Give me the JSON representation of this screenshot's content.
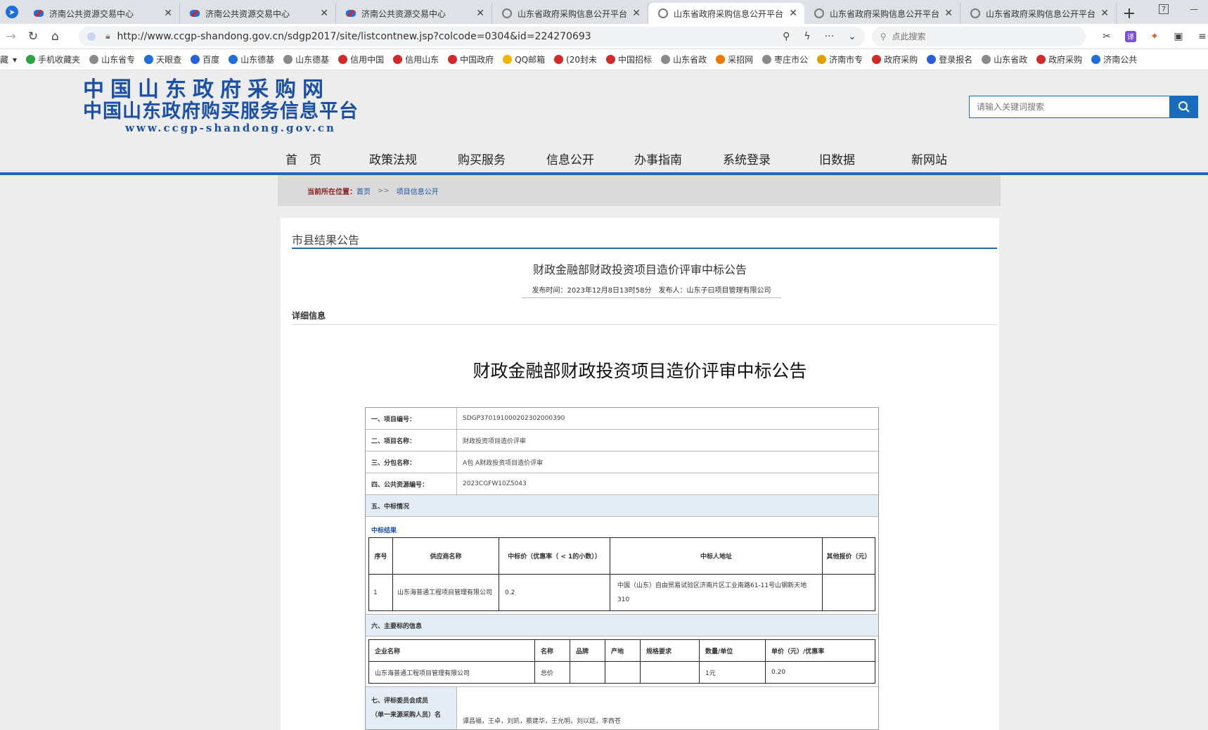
{
  "browser": {
    "tabs": [
      {
        "label": "济南公共资源交易中心",
        "active": false
      },
      {
        "label": "济南公共资源交易中心",
        "active": false
      },
      {
        "label": "济南公共资源交易中心",
        "active": false
      },
      {
        "label": "山东省政府采购信息公开平台",
        "active": false
      },
      {
        "label": "山东省政府采购信息公开平台",
        "active": true
      },
      {
        "label": "山东省政府采购信息公开平台",
        "active": false
      },
      {
        "label": "山东省政府采购信息公开平台",
        "active": false
      }
    ],
    "close_glyph": "✕",
    "new_tab_glyph": "+",
    "tab_badge": "7",
    "url": "http://www.ccgp-shandong.gov.cn/sdgp2017/site/listcontnew.jsp?colcode=0304&id=224270693",
    "search_placeholder": "点此搜索",
    "bookmarks": [
      {
        "label": "藏",
        "color": "#ffffff"
      },
      {
        "label": "手机收藏夹",
        "color": "#2ba245"
      },
      {
        "label": "山东省专",
        "color": "#8a8a8a"
      },
      {
        "label": "天眼查",
        "color": "#1e6fd9"
      },
      {
        "label": "百度",
        "color": "#2b5ed8"
      },
      {
        "label": "山东德基",
        "color": "#1e6fd9"
      },
      {
        "label": "山东德基",
        "color": "#8a8a8a"
      },
      {
        "label": "信用中国",
        "color": "#d02a2a"
      },
      {
        "label": "信用山东",
        "color": "#d02a2a"
      },
      {
        "label": "中国政府",
        "color": "#d02a2a"
      },
      {
        "label": "QQ邮箱",
        "color": "#f0b400"
      },
      {
        "label": "(20封未",
        "color": "#d02a2a"
      },
      {
        "label": "中国招标",
        "color": "#d02a2a"
      },
      {
        "label": "山东省政",
        "color": "#8a8a8a"
      },
      {
        "label": "采招网",
        "color": "#f07a00"
      },
      {
        "label": "枣庄市公",
        "color": "#8a8a8a"
      },
      {
        "label": "济南市专",
        "color": "#e2a000"
      },
      {
        "label": "政府采购",
        "color": "#d02a2a"
      },
      {
        "label": "登录报名",
        "color": "#2b5ed8"
      },
      {
        "label": "山东省政",
        "color": "#8a8a8a"
      },
      {
        "label": "政府采购",
        "color": "#d02a2a"
      },
      {
        "label": "济南公共",
        "color": "#1e6fd9"
      }
    ]
  },
  "site": {
    "logo_line1": "中国山东政府采购网",
    "logo_line2": "中国山东政府购买服务信息平台",
    "logo_line3": "www.ccgp-shandong.gov.cn",
    "search_placeholder": "请输入关键词搜索",
    "nav": [
      "首　页",
      "政策法规",
      "购买服务",
      "信息公开",
      "办事指南",
      "系统登录",
      "旧数据",
      "新网站"
    ],
    "breadcrumb": {
      "label": "当前所在位置：",
      "home": "首页",
      "sep": ">>",
      "current": "项目信息公开"
    },
    "accent": "#1b6bbd"
  },
  "article": {
    "section_title": "市县结果公告",
    "title": "财政金融部财政投资项目造价评审中标公告",
    "meta": "发布时间：2023年12月8日13时58分　发布人：山东子曰项目管理有限公司",
    "detail_label": "详细信息",
    "big_title": "财政金融部财政投资项目造价评审中标公告",
    "fields": [
      {
        "k": "一、项目编号：",
        "v": "SDGP370191000202302000390"
      },
      {
        "k": "二、项目名称：",
        "v": "财政投资项目造价评审"
      },
      {
        "k": "三、分包名称：",
        "v": "A包 A财政投资项目造价评审"
      },
      {
        "k": "四、公共资源编号：",
        "v": "2023CGFW10Z5043"
      }
    ],
    "sec5": "五、中标情况",
    "win_heading": "中标结果",
    "win_headers": [
      "序号",
      "供应商名称",
      "中标价（优惠率（ < 1的小数））",
      "中标人地址",
      "其他报价（元）"
    ],
    "win_row": [
      "1",
      "山东海普通工程项目管理有限公司",
      "0.2",
      "中国（山东）自由贸易试验区济南片区工业南路61-11号山钢新天地310",
      ""
    ],
    "sec6": "六、主要标的信息",
    "main_headers": [
      "企业名称",
      "名称",
      "品牌",
      "产地",
      "规格要求",
      "数量/单位",
      "单价（元）/优惠率"
    ],
    "main_row": [
      "山东海普通工程项目管理有限公司",
      "总价",
      "",
      "",
      "",
      "1元",
      "0.20"
    ],
    "sec7_line1": "七、评标委员会成员",
    "sec7_line2": "（单一来源采购人员）名",
    "sec7_value": "谭昌福，王卓，刘凯，蔡建华，王允明，刘以廷，李西苍"
  }
}
